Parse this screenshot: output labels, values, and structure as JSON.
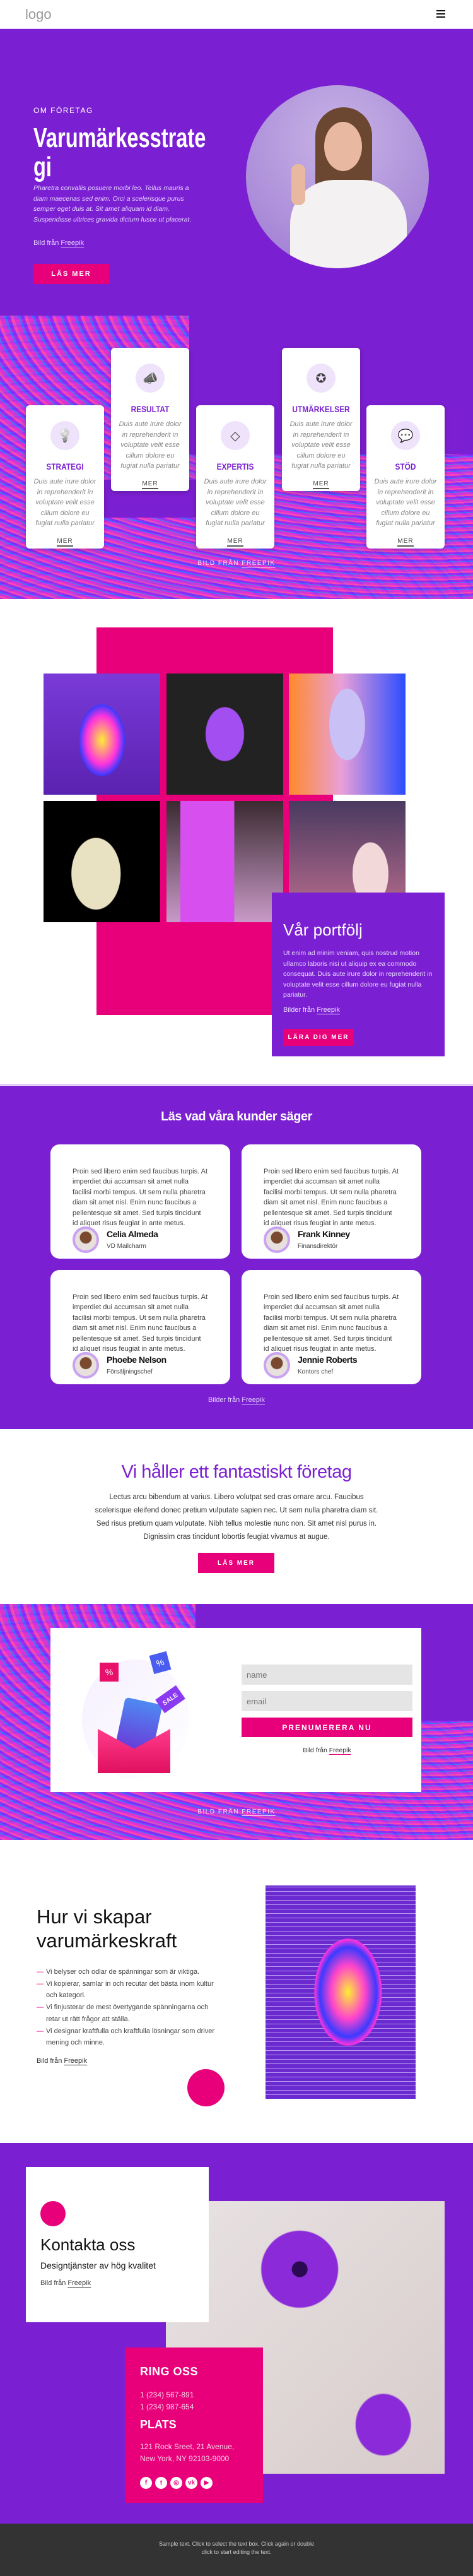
{
  "header": {
    "logo": "logo",
    "menu_icon": "hamburger-icon"
  },
  "hero": {
    "eyebrow": "OM FÖRETAG",
    "title": "Varumärkesstrategi",
    "text": "Pharetra convallis posuere morbi leo. Tellus mauris a diam maecenas sed enim. Orci a scelerisque purus semper eget duis at. Sit amet aliquam id diam. Suspendisse ultrices gravida dictum fusce ut placerat.",
    "credit_prefix": "Bild från",
    "credit_link": "Freepik",
    "button": "LÄS MER"
  },
  "features": {
    "cards": [
      {
        "title": "STRATEGI",
        "icon": "lightbulb-hand-icon",
        "text": "Duis aute irure dolor in reprehenderit in voluptate velit esse cillum dolore eu fugiat nulla pariatur",
        "link": "MER"
      },
      {
        "title": "RESULTAT",
        "icon": "megaphone-icon",
        "text": "Duis aute irure dolor in reprehenderit in voluptate velit esse cillum dolore eu fugiat nulla pariatur",
        "link": "MER"
      },
      {
        "title": "EXPERTIS",
        "icon": "diamond-icon",
        "text": "Duis aute irure dolor in reprehenderit in voluptate velit esse cillum dolore eu fugiat nulla pariatur",
        "link": "MER"
      },
      {
        "title": "UTMÄRKELSER",
        "icon": "award-badge-icon",
        "text": "Duis aute irure dolor in reprehenderit in voluptate velit esse cillum dolore eu fugiat nulla pariatur",
        "link": "MER"
      },
      {
        "title": "STÖD",
        "icon": "chat-bubbles-icon",
        "text": "Duis aute irure dolor in reprehenderit in voluptate velit esse cillum dolore eu fugiat nulla pariatur",
        "link": "MER"
      }
    ],
    "credit_prefix": "BILD FRÅN",
    "credit_link": "FREEPIK"
  },
  "portfolio": {
    "title": "Vår portfölj",
    "text": "Ut enim ad minim veniam, quis nostrud motion ullamco laboris nisi ut aliquip ex ea commodo consequat. Duis aute irure dolor in reprehenderit in voluptate velit esse cillum dolore eu fugiat nulla pariatur.",
    "credit_prefix": "Bilder från",
    "credit_link": "Freepik",
    "button": "LÄRA DIG MER"
  },
  "testimonials": {
    "title": "Läs vad våra kunder säger",
    "items": [
      {
        "text": "Proin sed libero enim sed faucibus turpis. At imperdiet dui accumsan sit amet nulla facilisi morbi tempus. Ut sem nulla pharetra diam sit amet nisl. Enim nunc faucibus a pellentesque sit amet. Sed turpis tincidunt id aliquet risus feugiat in ante metus.",
        "name": "Celia Almeda",
        "role": "VD Mailcharm"
      },
      {
        "text": "Proin sed libero enim sed faucibus turpis. At imperdiet dui accumsan sit amet nulla facilisi morbi tempus. Ut sem nulla pharetra diam sit amet nisl. Enim nunc faucibus a pellentesque sit amet. Sed turpis tincidunt id aliquet risus feugiat in ante metus.",
        "name": "Frank Kinney",
        "role": "Finansdirektör"
      },
      {
        "text": "Proin sed libero enim sed faucibus turpis. At imperdiet dui accumsan sit amet nulla facilisi morbi tempus. Ut sem nulla pharetra diam sit amet nisl. Enim nunc faucibus a pellentesque sit amet. Sed turpis tincidunt id aliquet risus feugiat in ante metus.",
        "name": "Phoebe Nelson",
        "role": "Försäljningschef"
      },
      {
        "text": "Proin sed libero enim sed faucibus turpis. At imperdiet dui accumsan sit amet nulla facilisi morbi tempus. Ut sem nulla pharetra diam sit amet nisl. Enim nunc faucibus a pellentesque sit amet. Sed turpis tincidunt id aliquet risus feugiat in ante metus.",
        "name": "Jennie Roberts",
        "role": "Kontors chef"
      }
    ],
    "credit_prefix": "Bilder från",
    "credit_link": "Freepik"
  },
  "company": {
    "title": "Vi håller ett fantastiskt företag",
    "text": "Lectus arcu bibendum at varius. Libero volutpat sed cras ornare arcu. Faucibus scelerisque eleifend donec pretium vulputate sapien nec. Ut sem nulla pharetra diam sit. Sed risus pretium quam vulputate. Nibh tellus molestie nunc non. Sit amet nisl purus in. Dignissim cras tincidunt lobortis feugiat vivamus at augue.",
    "button": "LÄS MER"
  },
  "subscribe": {
    "name_placeholder": "name",
    "email_placeholder": "email",
    "button": "PRENUMERERA NU",
    "credit_prefix": "Bild från",
    "credit_link": "Freepik",
    "bg_credit_prefix": "BILD FRÅN",
    "bg_credit_link": "FREEPIK"
  },
  "process": {
    "title": "Hur vi skapar varumärkeskraft",
    "items": [
      "Vi belyser och odlar de spänningar som är viktiga.",
      "Vi kopierar, samlar in och recutar det bästa inom kultur och kategori.",
      "Vi finjusterar de mest övertygande spänningarna och retar ut rätt frågor att ställa.",
      "Vi designar kraftfulla och kraftfulla lösningar som driver mening och minne."
    ],
    "credit_prefix": "Bild från",
    "credit_link": "Freepik"
  },
  "contact": {
    "title": "Kontakta oss",
    "subtitle": "Designtjänster av hög kvalitet",
    "credit_prefix": "Bild från",
    "credit_link": "Freepik",
    "phone_heading": "RING OSS",
    "phones": [
      "1 (234) 567-891",
      "1 (234) 987-654"
    ],
    "place_heading": "PLATS",
    "address": [
      "121 Rock Sreet, 21 Avenue,",
      "New York, NY 92103-9000"
    ],
    "social": [
      {
        "icon": "facebook-icon",
        "glyph": "f"
      },
      {
        "icon": "twitter-icon",
        "glyph": "t"
      },
      {
        "icon": "instagram-icon",
        "glyph": "◎"
      },
      {
        "icon": "vk-icon",
        "glyph": "vk"
      },
      {
        "icon": "youtube-icon",
        "glyph": "▶"
      }
    ]
  },
  "footer": {
    "text": "Sample text. Click to select the text box. Click again or double click to start editing the text."
  },
  "colors": {
    "purple": "#7b1fd2",
    "pink": "#e8007a",
    "footer": "#333333"
  }
}
